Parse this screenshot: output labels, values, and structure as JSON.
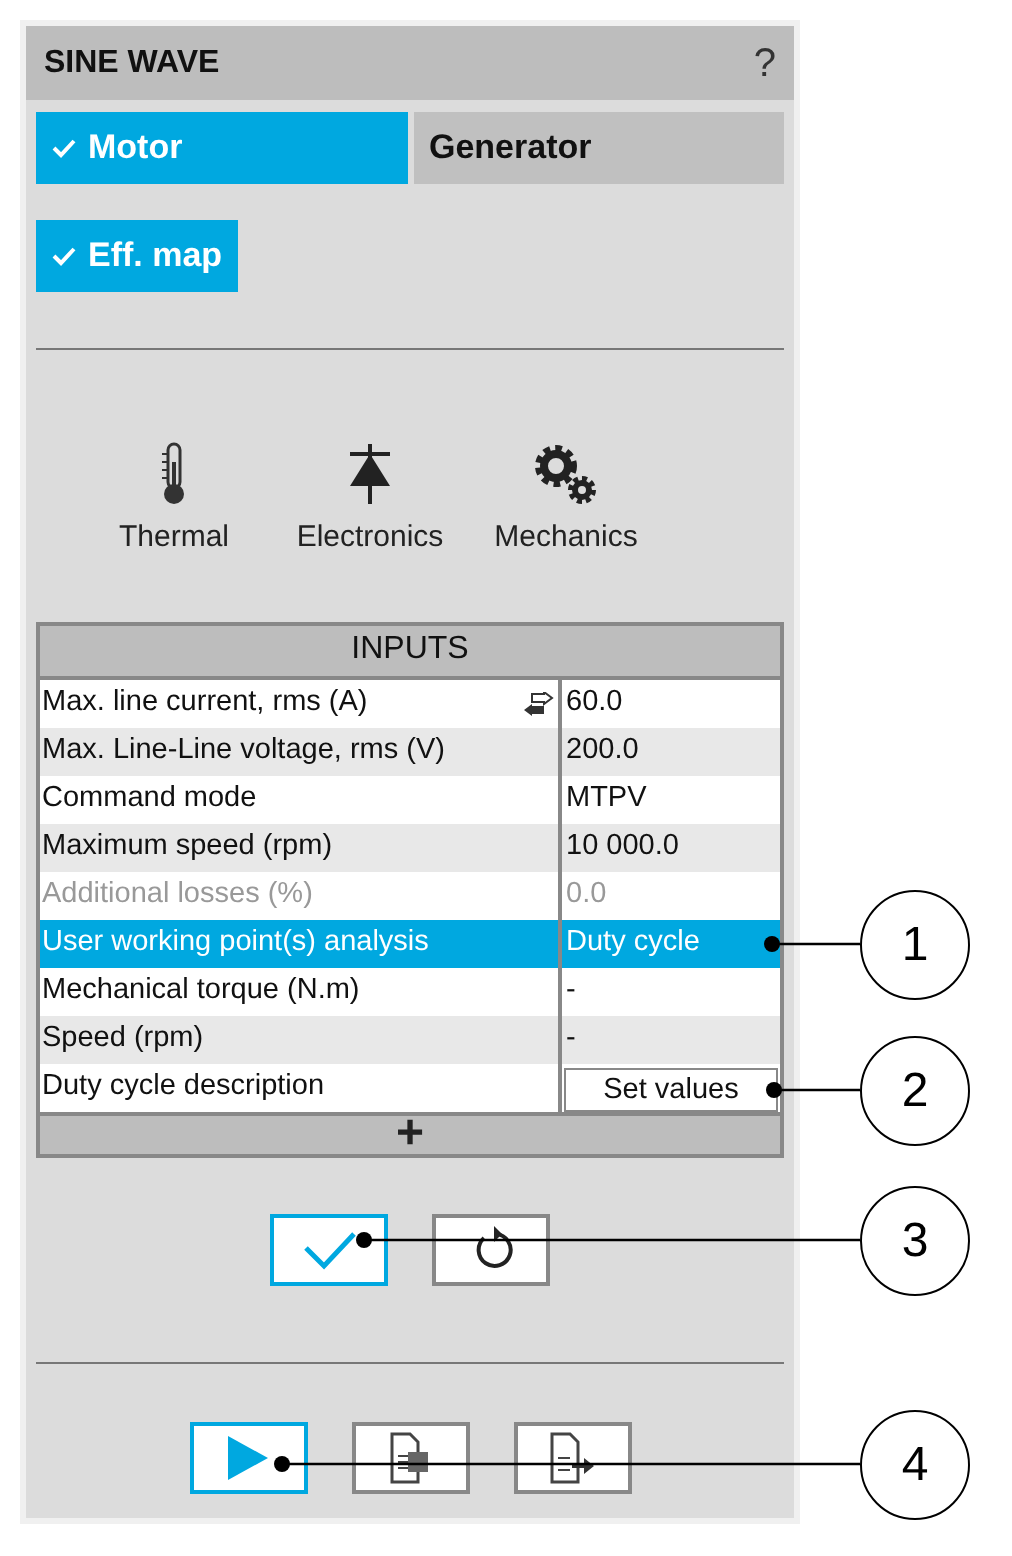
{
  "title": "SINE WAVE",
  "help": "?",
  "tabs": [
    {
      "label": "Motor",
      "selected": true
    },
    {
      "label": "Generator",
      "selected": false
    }
  ],
  "options": [
    {
      "label": "Eff. map",
      "checked": true
    }
  ],
  "categories": [
    {
      "kind": "thermal",
      "label": "Thermal"
    },
    {
      "kind": "electronics",
      "label": "Electronics"
    },
    {
      "kind": "mechanics",
      "label": "Mechanics"
    }
  ],
  "inputs": {
    "title": "INPUTS",
    "add": "+",
    "rows": [
      {
        "label": "Max. line current, rms (A)",
        "value": "60.0",
        "kind": "text",
        "swap_icon": true,
        "disabled": false,
        "selected": false
      },
      {
        "label": "Max. Line-Line voltage, rms (V)",
        "value": "200.0",
        "kind": "text",
        "swap_icon": false,
        "disabled": false,
        "selected": false
      },
      {
        "label": "Command mode",
        "value": "MTPV",
        "kind": "text",
        "swap_icon": false,
        "disabled": false,
        "selected": false
      },
      {
        "label": "Maximum speed (rpm)",
        "value": "10 000.0",
        "kind": "text",
        "swap_icon": false,
        "disabled": false,
        "selected": false
      },
      {
        "label": "Additional losses (%)",
        "value": "0.0",
        "kind": "text",
        "swap_icon": false,
        "disabled": true,
        "selected": false
      },
      {
        "label": "User working point(s) analysis",
        "value": "Duty cycle",
        "kind": "text",
        "swap_icon": false,
        "disabled": false,
        "selected": true
      },
      {
        "label": "Mechanical torque (N.m)",
        "value": "-",
        "kind": "text",
        "swap_icon": false,
        "disabled": false,
        "selected": false
      },
      {
        "label": "Speed (rpm)",
        "value": "-",
        "kind": "text",
        "swap_icon": false,
        "disabled": false,
        "selected": false
      },
      {
        "label": "Duty cycle description",
        "value": "Set values",
        "kind": "button",
        "swap_icon": false,
        "disabled": false,
        "selected": false
      }
    ]
  },
  "callouts": [
    "1",
    "2",
    "3",
    "4"
  ]
}
